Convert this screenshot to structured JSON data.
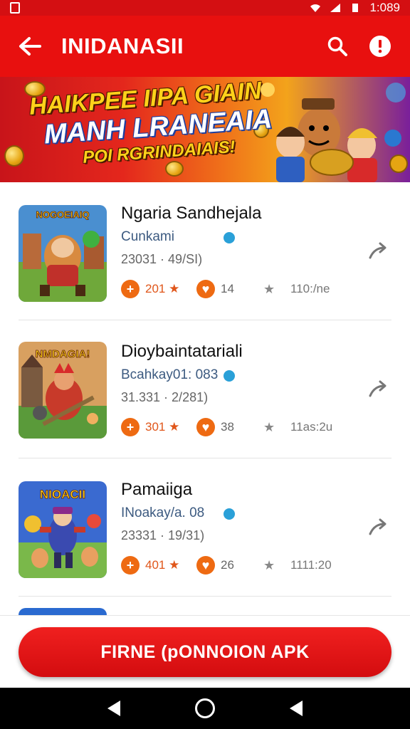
{
  "status_bar": {
    "time": "1:089"
  },
  "app_bar": {
    "title": "INIDANASII"
  },
  "banner": {
    "line1": "HAIKPEE IIPA GIAIN",
    "line2": "MANH LRANEAIA",
    "line3": "POI RGRINDAIAIS!"
  },
  "items": [
    {
      "name": "Ngaria Sandhejala",
      "developer": "Cunkami",
      "meta": "23031 · 49/SI)",
      "rating": "201 ★",
      "count": "14",
      "size": "110:/ne"
    },
    {
      "name": "Dioybaintatariali",
      "developer": "Bcahkay01: 083",
      "meta": "31.331 · 2/281)",
      "rating": "301 ★",
      "count": "38",
      "size": "11as:2u"
    },
    {
      "name": "Pamaiiga",
      "developer": "INoakay/a. 08",
      "meta": "23331 · 19/31)",
      "rating": "401 ★",
      "count": "26",
      "size": "1111:20"
    }
  ],
  "thumb_titles": [
    "NOGOEIAIQ",
    "NMDAGIA!",
    "NIOACII"
  ],
  "cta": {
    "label": "FIRNE (pONNOION APK"
  },
  "colors": {
    "primary": "#e8100f",
    "accent": "#ee6a12"
  }
}
